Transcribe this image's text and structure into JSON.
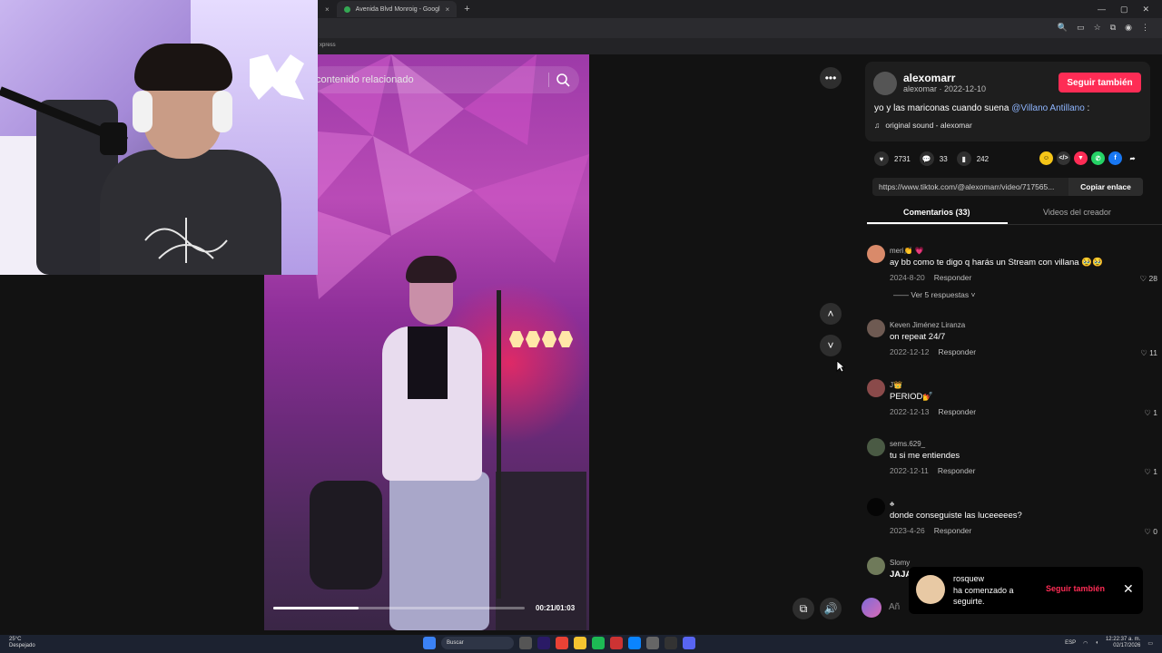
{
  "browser": {
    "tab_label": "Avenida Blvd Monroig - Googl",
    "tab_close": "×",
    "new_tab": "+",
    "window_controls": [
      "—",
      "▢",
      "✕"
    ],
    "bookmark_text": "xpress"
  },
  "video": {
    "search_placeholder": "contenido relacionado",
    "progress": 0.34,
    "timecode": "00:21/01:03"
  },
  "author": {
    "username": "alexomarr",
    "subline": "alexomar · 2022-12-10",
    "follow_label": "Seguir también",
    "caption_text": "yo y las mariconas cuando suena ",
    "caption_mention": "@Villano Antillano",
    "caption_end": " :",
    "sound_label": "original sound - alexomar"
  },
  "stats": {
    "likes": "2731",
    "comments": "33",
    "saves": "242"
  },
  "share": {
    "link": "https://www.tiktok.com/@alexomarr/video/717565...",
    "copy_label": "Copiar enlace"
  },
  "tabs": {
    "comments_tab": "Comentarios (33)",
    "creator_tab": "Videos del creador"
  },
  "comments": [
    {
      "user": "meri👏 💗",
      "text": "ay bb como te digo q harás un Stream con villana 🥹🥹",
      "date": "2024-8-20",
      "reply": "Responder",
      "likes": "28"
    },
    {
      "user": "Keven Jiménez Liranza",
      "text": "on repeat 24/7",
      "date": "2022-12-12",
      "reply": "Responder",
      "likes": "11"
    },
    {
      "user": "J👑",
      "text": "PERIOD💅",
      "date": "2022-12-13",
      "reply": "Responder",
      "likes": "1"
    },
    {
      "user": "sems.629_",
      "text": "tu si me entiendes",
      "date": "2022-12-11",
      "reply": "Responder",
      "likes": "1"
    },
    {
      "user": "♣",
      "text": "donde conseguiste las luceeeees?",
      "date": "2023-4-26",
      "reply": "Responder",
      "likes": "0"
    },
    {
      "user": "Slomy",
      "text": "JAJA",
      "date": "",
      "reply": "",
      "likes": ""
    }
  ],
  "replies_toggle": "Ver 5 respuestas",
  "input": {
    "placeholder": "Añ"
  },
  "toast": {
    "name": "rosquew",
    "message": "ha comenzado a seguirte.",
    "follow_label": "Seguir también",
    "close": "✕"
  },
  "taskbar": {
    "temp": "25°C",
    "weather": "Despejado",
    "search": "Buscar",
    "lang": "ESP",
    "time": "12:22:37 a. m.",
    "date": "02/17/2026"
  },
  "colors": {
    "accent": "#fe2c55",
    "background": "#121212",
    "mention": "#8fb6ff"
  }
}
